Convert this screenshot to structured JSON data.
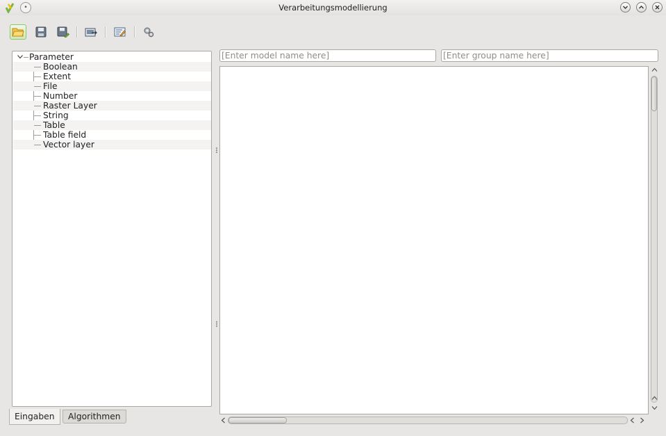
{
  "window": {
    "title": "Verarbeitungsmodellierung",
    "menu_glyph": "•"
  },
  "title_buttons": [
    "minimize-icon",
    "maximize-icon",
    "close-icon"
  ],
  "toolbar": {
    "buttons": [
      {
        "name": "open-model-button",
        "icon": "folder-open-icon"
      },
      {
        "name": "save-model-button",
        "icon": "floppy-disk-icon"
      },
      {
        "name": "save-as-button",
        "icon": "floppy-disk-edit-icon"
      },
      {
        "name": "export-image-button",
        "icon": "export-image-icon"
      },
      {
        "name": "edit-help-button",
        "icon": "edit-help-icon"
      },
      {
        "name": "run-model-button",
        "icon": "gears-icon"
      }
    ]
  },
  "tree": {
    "root_label": "Parameter",
    "items": [
      "Boolean",
      "Extent",
      "File",
      "Number",
      "Raster Layer",
      "String",
      "Table",
      "Table field",
      "Vector layer"
    ]
  },
  "tabs": [
    {
      "label": "Eingaben",
      "selected": true
    },
    {
      "label": "Algorithmen",
      "selected": false
    }
  ],
  "fields": {
    "model_name": {
      "value": "",
      "placeholder": "[Enter model name here]"
    },
    "group_name": {
      "value": "",
      "placeholder": "[Enter group name here]"
    }
  },
  "colors": {
    "window_bg": "#e8e6e4",
    "active_button": "#cfe8b8",
    "canvas_bg": "#ffffff"
  }
}
